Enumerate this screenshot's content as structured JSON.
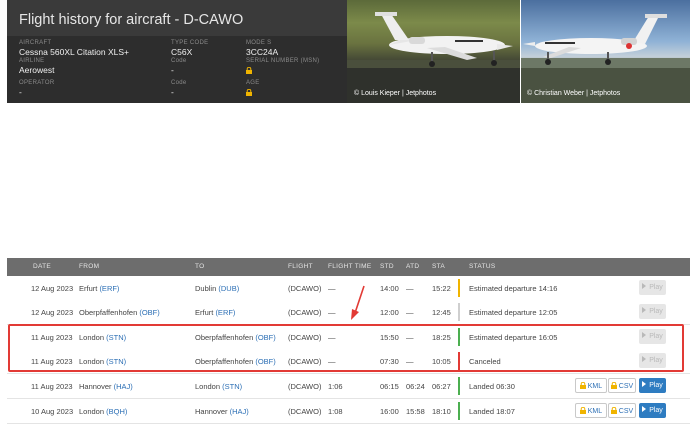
{
  "header": {
    "title": "Flight history for aircraft - D-CAWO",
    "aircraft_label": "AIRCRAFT",
    "aircraft": "Cessna 560XL Citation XLS+",
    "type_code_label": "TYPE CODE",
    "type_code": "C56X",
    "mode_s_label": "MODE S",
    "mode_s": "3CC24A",
    "airline_label": "AIRLINE",
    "airline": "Aerowest",
    "airline_code_label": "Code",
    "airline_code": "-",
    "serial_label": "SERIAL NUMBER (MSN)",
    "operator_label": "OPERATOR",
    "operator": "-",
    "operator_code_label": "Code",
    "operator_code": "-",
    "age_label": "AGE"
  },
  "photos": [
    {
      "credit": "© Louis Kieper | Jetphotos"
    },
    {
      "credit": "© Christian Weber | Jetphotos"
    }
  ],
  "table": {
    "headers": {
      "date": "DATE",
      "from": "FROM",
      "to": "TO",
      "flight": "FLIGHT",
      "flight_time": "FLIGHT TIME",
      "std": "STD",
      "atd": "ATD",
      "sta": "STA",
      "status": "STATUS"
    },
    "rows": [
      {
        "date": "12 Aug 2023",
        "from_city": "Erfurt",
        "from_code": "(ERF)",
        "to_city": "Dublin",
        "to_code": "(DUB)",
        "flight": "(DCAWO)",
        "flight_time": "—",
        "std": "14:00",
        "atd": "—",
        "sta": "15:22",
        "status": "Estimated departure 14:16",
        "status_color": "#f0b400",
        "play": "Play"
      },
      {
        "date": "12 Aug 2023",
        "from_city": "Oberpfaffenhofen",
        "from_code": "(OBF)",
        "to_city": "Erfurt",
        "to_code": "(ERF)",
        "flight": "(DCAWO)",
        "flight_time": "—",
        "std": "12:00",
        "atd": "—",
        "sta": "12:45",
        "status": "Estimated departure 12:05",
        "status_color": "#cfcfcf",
        "play": "Play"
      },
      {
        "date": "11 Aug 2023",
        "from_city": "London",
        "from_code": "(STN)",
        "to_city": "Oberpfaffenhofen",
        "to_code": "(OBF)",
        "flight": "(DCAWO)",
        "flight_time": "—",
        "std": "15:50",
        "atd": "—",
        "sta": "18:25",
        "status": "Estimated departure 16:05",
        "status_color": "#4caf50",
        "play": "Play"
      },
      {
        "date": "11 Aug 2023",
        "from_city": "London",
        "from_code": "(STN)",
        "to_city": "Oberpfaffenhofen",
        "to_code": "(OBF)",
        "flight": "(DCAWO)",
        "flight_time": "—",
        "std": "07:30",
        "atd": "—",
        "sta": "10:05",
        "status": "Canceled",
        "status_color": "#e23a35",
        "play": "Play"
      },
      {
        "date": "11 Aug 2023",
        "from_city": "Hannover",
        "from_code": "(HAJ)",
        "to_city": "London",
        "to_code": "(STN)",
        "flight": "(DCAWO)",
        "flight_time": "1:06",
        "std": "06:15",
        "atd": "06:24",
        "sta": "06:27",
        "status": "Landed 06:30",
        "status_color": "#4caf50",
        "kml": "KML",
        "csv": "CSV",
        "play": "Play"
      },
      {
        "date": "10 Aug 2023",
        "from_city": "London",
        "from_code": "(BQH)",
        "to_city": "Hannover",
        "to_code": "(HAJ)",
        "flight": "(DCAWO)",
        "flight_time": "1:08",
        "std": "16:00",
        "atd": "15:58",
        "sta": "18:10",
        "status": "Landed 18:07",
        "status_color": "#4caf50",
        "kml": "KML",
        "csv": "CSV",
        "play": "Play"
      }
    ]
  },
  "colors": {
    "highlight": "#e23a35",
    "link": "#2c6fb5",
    "play_active": "#2e7cc1",
    "lock": "#f0b400"
  }
}
